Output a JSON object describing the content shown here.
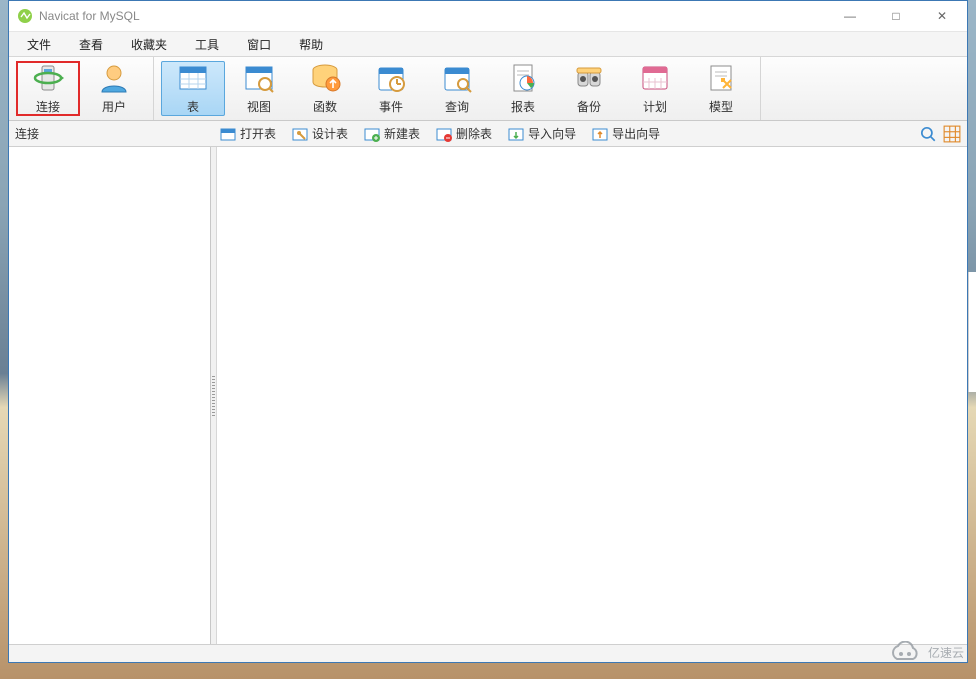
{
  "title": "Navicat for MySQL",
  "window_controls": {
    "min": "—",
    "max": "□",
    "close": "✕"
  },
  "menu": [
    "文件",
    "查看",
    "收藏夹",
    "工具",
    "窗口",
    "帮助"
  ],
  "toolbar_groups": [
    {
      "items": [
        {
          "id": "connect",
          "label": "连接",
          "icon": "connect-icon",
          "highlight": true
        },
        {
          "id": "user",
          "label": "用户",
          "icon": "user-icon"
        }
      ]
    },
    {
      "items": [
        {
          "id": "table",
          "label": "表",
          "icon": "table-icon",
          "active": true
        },
        {
          "id": "view",
          "label": "视图",
          "icon": "view-icon"
        },
        {
          "id": "func",
          "label": "函数",
          "icon": "function-icon"
        },
        {
          "id": "event",
          "label": "事件",
          "icon": "event-icon"
        },
        {
          "id": "query",
          "label": "查询",
          "icon": "query-icon"
        },
        {
          "id": "report",
          "label": "报表",
          "icon": "report-icon"
        },
        {
          "id": "backup",
          "label": "备份",
          "icon": "backup-icon"
        },
        {
          "id": "plan",
          "label": "计划",
          "icon": "plan-icon"
        },
        {
          "id": "model",
          "label": "模型",
          "icon": "model-icon"
        }
      ]
    }
  ],
  "subbar_left_label": "连接",
  "subbar_buttons": [
    {
      "id": "open-table",
      "label": "打开表",
      "icon": "mini-open-icon"
    },
    {
      "id": "design-table",
      "label": "设计表",
      "icon": "mini-design-icon"
    },
    {
      "id": "new-table",
      "label": "新建表",
      "icon": "mini-new-icon"
    },
    {
      "id": "delete-table",
      "label": "删除表",
      "icon": "mini-delete-icon"
    },
    {
      "id": "import-wiz",
      "label": "导入向导",
      "icon": "mini-import-icon"
    },
    {
      "id": "export-wiz",
      "label": "导出向导",
      "icon": "mini-export-icon"
    }
  ],
  "subbar_right_icons": [
    "search-icon",
    "grid-view-icon"
  ],
  "watermark": "亿速云",
  "colors": {
    "accent": "#3c78b4",
    "highlight": "#e12a2a",
    "active_bg": "#a9d6f5"
  }
}
